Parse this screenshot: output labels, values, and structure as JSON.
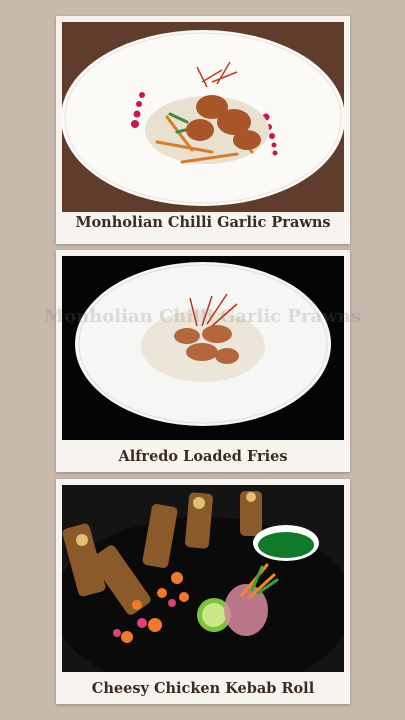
{
  "cards": [
    {
      "caption": "Monholian Chilli Garlic Prawns"
    },
    {
      "caption": "Alfredo Loaded Fries"
    },
    {
      "caption": "Cheesy Chicken Kebab Roll"
    }
  ],
  "watermark": "Monholian Chilli Garlic Prawns",
  "colors": {
    "background": "#c7b9ac",
    "card": "#f7f4ef",
    "caption_text": "#3b2b22"
  }
}
